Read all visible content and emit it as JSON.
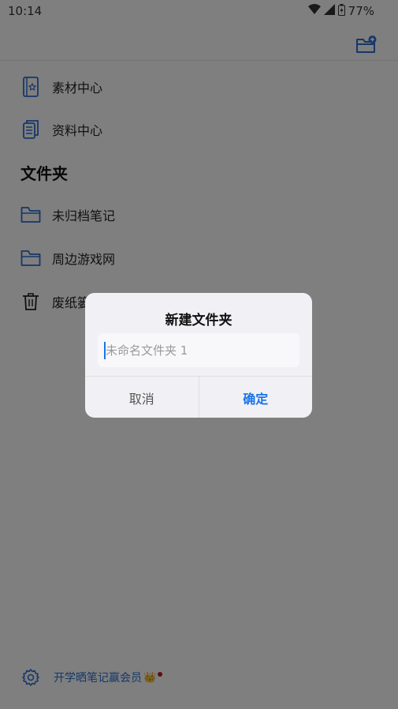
{
  "status_bar": {
    "time": "10:14",
    "battery": "77%"
  },
  "menu": {
    "items": [
      {
        "label": "素材中心",
        "icon": "material-book-icon"
      },
      {
        "label": "资料中心",
        "icon": "document-stack-icon"
      }
    ]
  },
  "folders": {
    "title": "文件夹",
    "items": [
      {
        "label": "未归档笔记",
        "icon": "folder-icon"
      },
      {
        "label": "周边游戏网",
        "icon": "folder-icon"
      },
      {
        "label": "废纸篓",
        "icon": "trash-icon"
      }
    ]
  },
  "footer": {
    "promo_label": "开学晒笔记赢会员",
    "crown": "👑"
  },
  "dialog": {
    "title": "新建文件夹",
    "input_placeholder": "未命名文件夹 1",
    "input_value": "",
    "cancel_label": "取消",
    "confirm_label": "确定"
  },
  "colors": {
    "accent": "#1a73e8",
    "icon_blue": "#2c6fd1",
    "overlay": "rgba(0,0,0,0.5)"
  }
}
